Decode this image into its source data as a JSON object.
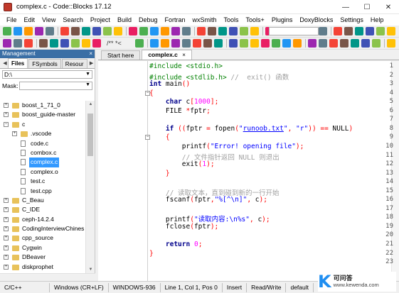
{
  "window": {
    "title": "complex.c - Code::Blocks 17.12",
    "controls": [
      "—",
      "☐",
      "✕"
    ]
  },
  "menu": [
    "File",
    "Edit",
    "View",
    "Search",
    "Project",
    "Build",
    "Debug",
    "Fortran",
    "wxSmith",
    "Tools",
    "Tools+",
    "Plugins",
    "DoxyBlocks",
    "Settings",
    "Help"
  ],
  "toolbar": {
    "doc_comment_label": "/** *<",
    "icon_colors": [
      "#4caf50",
      "#2196f3",
      "#ff9800",
      "#9c27b0",
      "#607d8b",
      "#f44336",
      "#795548",
      "#009688",
      "#3f51b5",
      "#8bc34a",
      "#ffc107",
      "#e91e63"
    ]
  },
  "management": {
    "title": "Management",
    "close_glyph": "×",
    "tabs": [
      "Files",
      "FSymbols",
      "Resour"
    ],
    "drive": "D:\\",
    "mask_label": "Mask:",
    "tree": [
      {
        "label": "boost_1_71_0",
        "level": 0,
        "kind": "folder",
        "expander": "+"
      },
      {
        "label": "boost_guide-master",
        "level": 0,
        "kind": "folder",
        "expander": "+"
      },
      {
        "label": "c",
        "level": 0,
        "kind": "folder",
        "expander": "−"
      },
      {
        "label": ".vscode",
        "level": 1,
        "kind": "folder",
        "expander": "+"
      },
      {
        "label": "code.c",
        "level": 1,
        "kind": "file",
        "expander": ""
      },
      {
        "label": "combox.c",
        "level": 1,
        "kind": "file",
        "expander": ""
      },
      {
        "label": "complex.c",
        "level": 1,
        "kind": "file",
        "expander": "",
        "selected": true
      },
      {
        "label": "complex.o",
        "level": 1,
        "kind": "file",
        "expander": ""
      },
      {
        "label": "test.c",
        "level": 1,
        "kind": "file",
        "expander": ""
      },
      {
        "label": "test.cpp",
        "level": 1,
        "kind": "file",
        "expander": ""
      },
      {
        "label": "C_Beau",
        "level": 0,
        "kind": "folder",
        "expander": "+"
      },
      {
        "label": "C_IDE",
        "level": 0,
        "kind": "folder",
        "expander": "+"
      },
      {
        "label": "ceph-14.2.4",
        "level": 0,
        "kind": "folder",
        "expander": "+"
      },
      {
        "label": "CodingInterviewChines",
        "level": 0,
        "kind": "folder",
        "expander": "+"
      },
      {
        "label": "cpp_source",
        "level": 0,
        "kind": "folder",
        "expander": "+"
      },
      {
        "label": "Cygwin",
        "level": 0,
        "kind": "folder",
        "expander": "+"
      },
      {
        "label": "DBeaver",
        "level": 0,
        "kind": "folder",
        "expander": "+"
      },
      {
        "label": "diskprophet",
        "level": 0,
        "kind": "folder",
        "expander": "+"
      }
    ]
  },
  "editor": {
    "tabs": [
      {
        "label": "Start here",
        "active": false
      },
      {
        "label": "complex.c",
        "active": true,
        "close": "×"
      }
    ],
    "lines": [
      {
        "n": "1",
        "tokens": [
          {
            "t": "#include <stdio.h>",
            "c": "pp"
          }
        ]
      },
      {
        "n": "2",
        "tokens": [
          {
            "t": "#include <stdlib.h>",
            "c": "pp"
          },
          {
            "t": " //  exit() 函数",
            "c": "cmt"
          }
        ]
      },
      {
        "n": "3",
        "tokens": [
          {
            "t": "int",
            "c": "kw"
          },
          {
            "t": " main",
            "c": ""
          },
          {
            "t": "()",
            "c": "op"
          }
        ]
      },
      {
        "n": "4",
        "fold": "−",
        "tokens": [
          {
            "t": "{",
            "c": "brace"
          }
        ]
      },
      {
        "n": "5",
        "tokens": [
          {
            "t": "    ",
            "c": ""
          },
          {
            "t": "char",
            "c": "kw"
          },
          {
            "t": " c",
            "c": ""
          },
          {
            "t": "[",
            "c": "op"
          },
          {
            "t": "1000",
            "c": "num"
          },
          {
            "t": "];",
            "c": "op"
          }
        ]
      },
      {
        "n": "6",
        "tokens": [
          {
            "t": "    FILE ",
            "c": ""
          },
          {
            "t": "*",
            "c": "op"
          },
          {
            "t": "fptr",
            "c": ""
          },
          {
            "t": ";",
            "c": "op"
          }
        ]
      },
      {
        "n": "7",
        "tokens": []
      },
      {
        "n": "8",
        "tokens": [
          {
            "t": "    ",
            "c": ""
          },
          {
            "t": "if",
            "c": "kw"
          },
          {
            "t": " ((",
            "c": "op"
          },
          {
            "t": "fptr ",
            "c": ""
          },
          {
            "t": "=",
            "c": "op"
          },
          {
            "t": " fopen",
            "c": ""
          },
          {
            "t": "(",
            "c": "op"
          },
          {
            "t": "\"",
            "c": "str"
          },
          {
            "t": "runoob.txt",
            "c": "str under"
          },
          {
            "t": "\"",
            "c": "str"
          },
          {
            "t": ", ",
            "c": "op"
          },
          {
            "t": "\"r\"",
            "c": "str"
          },
          {
            "t": ")) == ",
            "c": "op"
          },
          {
            "t": "NULL",
            "c": ""
          },
          {
            "t": ")",
            "c": "op"
          }
        ]
      },
      {
        "n": "9",
        "fold": "−",
        "tokens": [
          {
            "t": "    ",
            "c": ""
          },
          {
            "t": "{",
            "c": "brace"
          }
        ]
      },
      {
        "n": "10",
        "tokens": [
          {
            "t": "        printf",
            "c": ""
          },
          {
            "t": "(",
            "c": "op"
          },
          {
            "t": "\"Error! opening file\"",
            "c": "str"
          },
          {
            "t": ");",
            "c": "op"
          }
        ]
      },
      {
        "n": "11",
        "tokens": [
          {
            "t": "        // 文件指针返回 NULL 则退出",
            "c": "cmt"
          }
        ]
      },
      {
        "n": "12",
        "tokens": [
          {
            "t": "        exit",
            "c": ""
          },
          {
            "t": "(",
            "c": "op"
          },
          {
            "t": "1",
            "c": "num"
          },
          {
            "t": ");",
            "c": "op"
          }
        ]
      },
      {
        "n": "13",
        "tokens": [
          {
            "t": "    ",
            "c": ""
          },
          {
            "t": "}",
            "c": "brace"
          }
        ]
      },
      {
        "n": "14",
        "tokens": []
      },
      {
        "n": "15",
        "tokens": [
          {
            "t": "    // 读取文本，直到碰到新的一行开始",
            "c": "cmt"
          }
        ]
      },
      {
        "n": "16",
        "tokens": [
          {
            "t": "    fscanf",
            "c": ""
          },
          {
            "t": "(",
            "c": "op"
          },
          {
            "t": "fptr",
            "c": ""
          },
          {
            "t": ",",
            "c": "op"
          },
          {
            "t": "\"%[^\\n]\"",
            "c": "str"
          },
          {
            "t": ", ",
            "c": "op"
          },
          {
            "t": "c",
            "c": ""
          },
          {
            "t": ");",
            "c": "op"
          }
        ]
      },
      {
        "n": "17",
        "tokens": []
      },
      {
        "n": "18",
        "tokens": [
          {
            "t": "    printf",
            "c": ""
          },
          {
            "t": "(",
            "c": "op"
          },
          {
            "t": "\"读取内容:\\n%s\"",
            "c": "str"
          },
          {
            "t": ", ",
            "c": "op"
          },
          {
            "t": "c",
            "c": ""
          },
          {
            "t": ");",
            "c": "op"
          }
        ]
      },
      {
        "n": "19",
        "tokens": [
          {
            "t": "    fclose",
            "c": ""
          },
          {
            "t": "(",
            "c": "op"
          },
          {
            "t": "fptr",
            "c": ""
          },
          {
            "t": ");",
            "c": "op"
          }
        ]
      },
      {
        "n": "20",
        "tokens": []
      },
      {
        "n": "21",
        "tokens": [
          {
            "t": "    ",
            "c": ""
          },
          {
            "t": "return",
            "c": "kw"
          },
          {
            "t": " ",
            "c": ""
          },
          {
            "t": "0",
            "c": "num"
          },
          {
            "t": ";",
            "c": "op"
          }
        ]
      },
      {
        "n": "22",
        "tokens": [
          {
            "t": "}",
            "c": "brace"
          }
        ]
      },
      {
        "n": "23",
        "tokens": []
      }
    ]
  },
  "status": {
    "language": "C/C++",
    "line_endings": "Windows (CR+LF)",
    "encoding": "WINDOWS-936",
    "position": "Line 1, Col 1, Pos 0",
    "mode": "Insert",
    "access": "Read/Write",
    "profile": "default"
  },
  "watermark": {
    "logo": "K",
    "name": "可问答",
    "url": "www.kewenda.com"
  }
}
